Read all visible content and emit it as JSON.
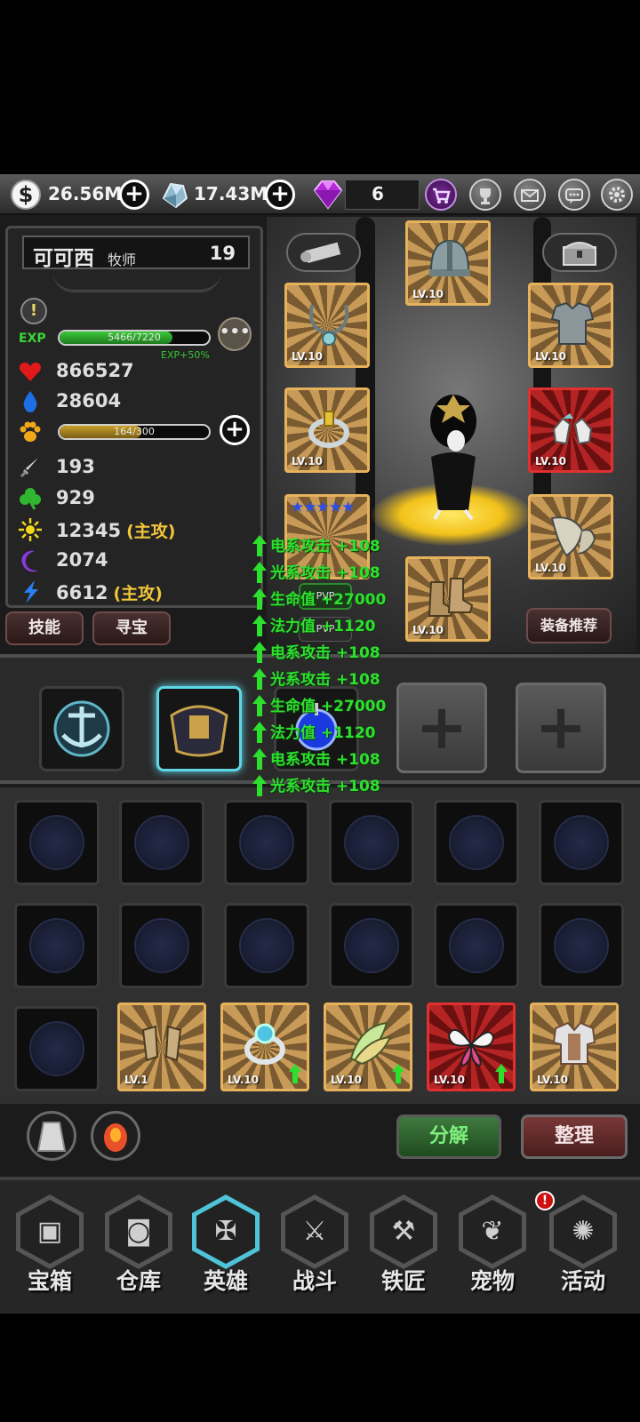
{
  "topbar": {
    "coins": "26.56M",
    "crystals": "17.43M",
    "gems": "6",
    "plus": "+"
  },
  "character": {
    "name": "可可西",
    "class": "牧师",
    "level": "19",
    "exp_label": "EXP",
    "exp_text": "5466/7220",
    "exp_progress": 0.757,
    "exp_bonus": "EXP+50%",
    "more": "•••",
    "hp": "866527",
    "mp": "28604",
    "pet_text": "164/300",
    "pet_progress": 0.547,
    "stats": [
      {
        "icon": "sword-icon",
        "value": "193",
        "tag": ""
      },
      {
        "icon": "clover-icon",
        "value": "929",
        "tag": ""
      },
      {
        "icon": "sun-icon",
        "value": "12345",
        "tag": "(主攻)"
      },
      {
        "icon": "moon-icon",
        "value": "2074",
        "tag": ""
      },
      {
        "icon": "lightning-icon",
        "value": "6612",
        "tag": "(主攻)"
      }
    ]
  },
  "buttons": {
    "skill": "技能",
    "treasure": "寻宝",
    "recommend": "装备推荐",
    "decompose": "分解",
    "organize": "整理",
    "pvp1": "PVP",
    "pvp2": "PVP"
  },
  "equipment": {
    "helmet_lv": "LV.10",
    "necklace_lv": "LV.10",
    "armor_lv": "LV.10",
    "ring_lv": "LV.10",
    "gloves_lv": "LV.10",
    "wings_lv": "LV.10",
    "boots_lv": "LV.10",
    "stars": "★★★★★"
  },
  "inventory": {
    "items": [
      {
        "name": "gloves",
        "lv": "LV.1",
        "upgrade": false,
        "rarity": "gold"
      },
      {
        "name": "ring",
        "lv": "LV.10",
        "upgrade": true,
        "rarity": "gold"
      },
      {
        "name": "wings",
        "lv": "LV.10",
        "upgrade": true,
        "rarity": "gold"
      },
      {
        "name": "butterfly-wings",
        "lv": "LV.10",
        "upgrade": true,
        "rarity": "red"
      },
      {
        "name": "armor",
        "lv": "LV.10",
        "upgrade": false,
        "rarity": "gold"
      }
    ]
  },
  "floating_stats": [
    "电系攻击 +108",
    "光系攻击 +108",
    "生命值 +27000",
    "法力值 +1120",
    "电系攻击 +108",
    "光系攻击 +108",
    "生命值 +27000",
    "法力值 +1120",
    "电系攻击 +108",
    "光系攻击 +108"
  ],
  "nav": [
    {
      "label": "宝箱",
      "icon": "chest-icon",
      "active": false
    },
    {
      "label": "仓库",
      "icon": "backpack-icon",
      "active": false
    },
    {
      "label": "英雄",
      "icon": "hero-icon",
      "active": true
    },
    {
      "label": "战斗",
      "icon": "battle-icon",
      "active": false
    },
    {
      "label": "铁匠",
      "icon": "anvil-icon",
      "active": false
    },
    {
      "label": "宠物",
      "icon": "pet-icon",
      "active": false
    },
    {
      "label": "活动",
      "icon": "event-icon",
      "active": false
    }
  ],
  "nav_badge": "!",
  "colors": {
    "accent_cyan": "#5fd6e6",
    "exp_green": "#37d637",
    "gold": "#f2c63a",
    "float_green": "#2ee02e"
  }
}
